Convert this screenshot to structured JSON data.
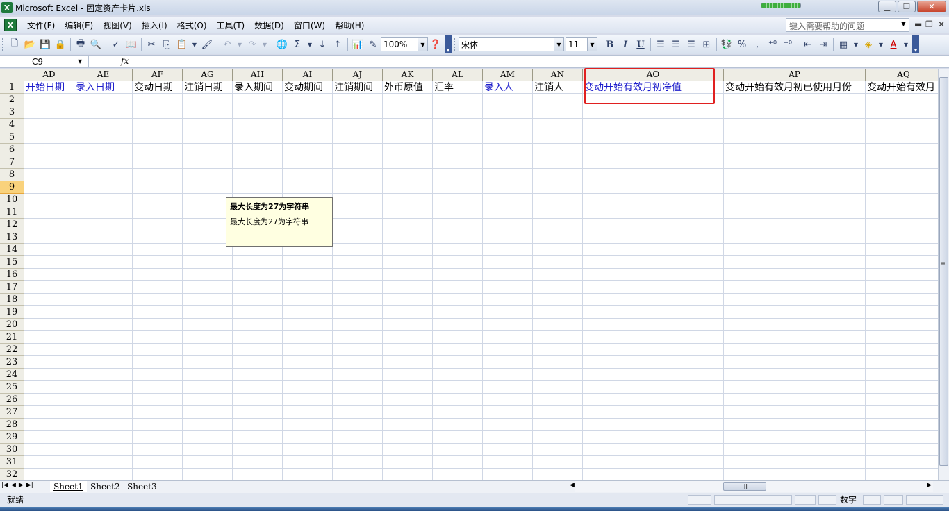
{
  "window": {
    "title": "Microsoft Excel - 固定资产卡片.xls",
    "minimize": "▁",
    "restore": "❐",
    "close": "✕"
  },
  "menu": {
    "items": [
      "文件(F)",
      "编辑(E)",
      "视图(V)",
      "插入(I)",
      "格式(O)",
      "工具(T)",
      "数据(D)",
      "窗口(W)",
      "帮助(H)"
    ],
    "help_placeholder": "键入需要帮助的问题",
    "doc_minimize": "▬",
    "doc_restore": "❐",
    "doc_close": "✕"
  },
  "toolbar": {
    "zoom": "100%",
    "font_name": "宋体",
    "font_size": "11",
    "bold": "B",
    "italic": "I",
    "underline": "U",
    "percent": "%",
    "comma": ","
  },
  "formula_bar": {
    "name_box": "C9",
    "fx": "fx",
    "content": ""
  },
  "grid": {
    "columns": [
      "AD",
      "AE",
      "AF",
      "AG",
      "AH",
      "AI",
      "AJ",
      "AK",
      "AL",
      "AM",
      "AN",
      "AO",
      "AP",
      "AQ"
    ],
    "header_row": [
      "开始日期",
      "录入日期",
      "变动日期",
      "注销日期",
      "录入期间",
      "变动期间",
      "注销期间",
      "外币原值",
      "汇率",
      "录入人",
      "注销人",
      "变动开始有效月初净值",
      "变动开始有效月初已使用月份",
      "变动开始有效月"
    ],
    "blue_columns": [
      0,
      1,
      9,
      11
    ],
    "rows": [
      "1",
      "2",
      "3",
      "4",
      "5",
      "6",
      "7",
      "8",
      "9",
      "10",
      "11",
      "12",
      "13",
      "14",
      "15",
      "16",
      "17",
      "18",
      "19",
      "20",
      "21",
      "22",
      "23",
      "24",
      "25",
      "26",
      "27",
      "28",
      "29",
      "30",
      "31",
      "32"
    ],
    "active_row": "9"
  },
  "tooltip": {
    "title": "最大长度为27为字符串",
    "body": "最大长度为27为字符串"
  },
  "sheets": [
    "Sheet1",
    "Sheet2",
    "Sheet3"
  ],
  "active_sheet": "Sheet1",
  "status": {
    "ready": "就绪",
    "mode": "数字"
  },
  "colors": {
    "blue_text": "#1c1ccb",
    "highlight": "#e02020",
    "tooltip_bg": "#ffffe1"
  }
}
